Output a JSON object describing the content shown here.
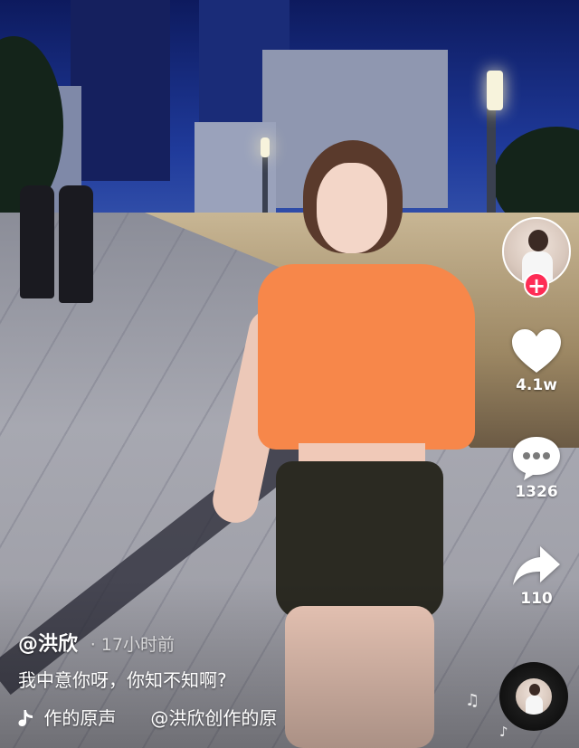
{
  "author": {
    "handle": "@洪欣",
    "time": "17小时前"
  },
  "caption": "我中意你呀，你知不知啊?",
  "music": {
    "left_text": "作的原声",
    "right_text": "@洪欣创作的原"
  },
  "actions": {
    "like_count": "4.1w",
    "comment_count": "1326",
    "share_count": "110"
  },
  "follow": {
    "symbol": "+"
  },
  "icons": {
    "like": "heart-icon",
    "comment": "comment-bubble-icon",
    "share": "share-arrow-icon",
    "music": "music-note-icon",
    "follow": "plus-icon"
  },
  "colors": {
    "accent": "#fe2c55",
    "text": "#ffffff"
  }
}
